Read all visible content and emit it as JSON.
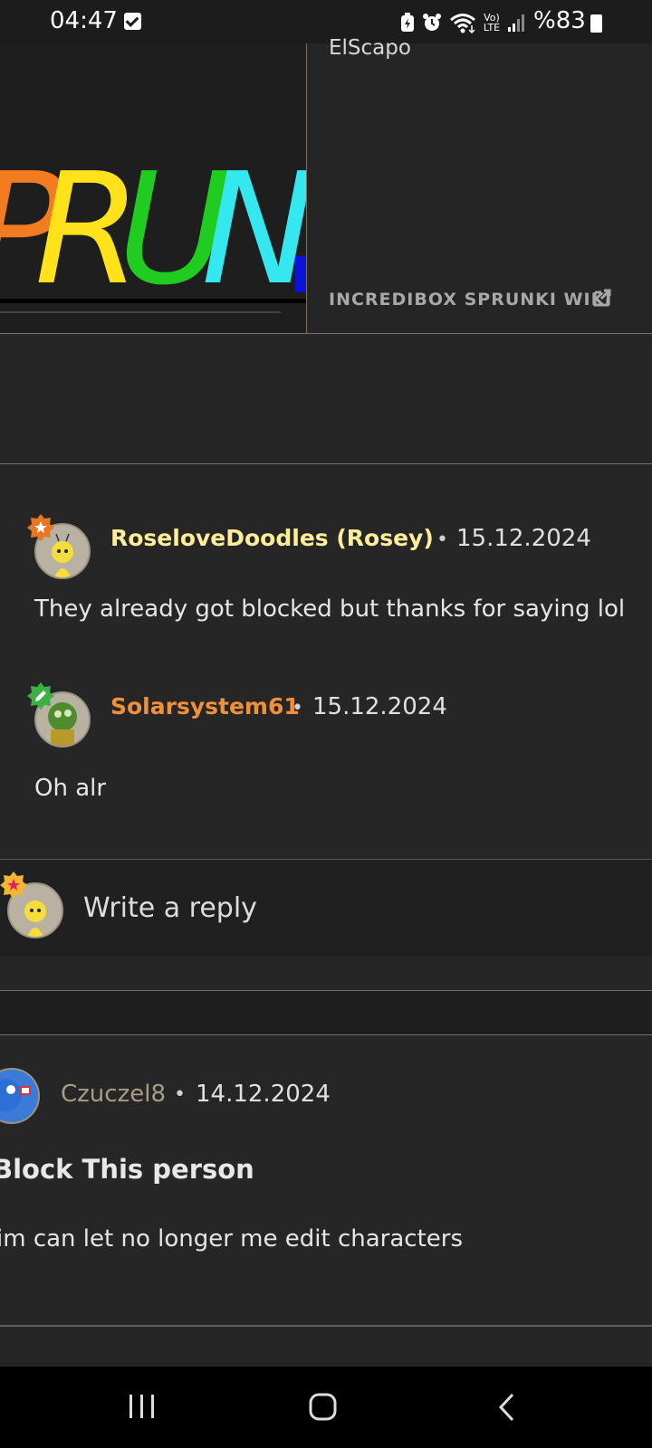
{
  "status_bar": {
    "time": "04:47",
    "battery": "%83",
    "icons": [
      "checkbox-notification-icon",
      "battery-saver-icon",
      "alarm-icon",
      "wifi-icon",
      "volte-icon",
      "signal-icon",
      "battery-icon"
    ]
  },
  "embed": {
    "image_text": "PRUN",
    "author": "ElScapo",
    "source": "INCREDIBOX SPRUNKI WIKI"
  },
  "replies": [
    {
      "username": "RoseloveDoodles (Rosey)",
      "username_color": "#ffee99",
      "separator": "•",
      "date": "15.12.2024",
      "text": "They already got blocked but thanks for saying lol",
      "badge_color": "#e87722"
    },
    {
      "username": "Solarsystem61",
      "username_color": "#f0913a",
      "separator": "•",
      "date": "15.12.2024",
      "text": "Oh alr",
      "badge_color": "#3cb043"
    }
  ],
  "reply_box": {
    "placeholder": "Write a reply",
    "badge_color": "#f2b632"
  },
  "comment": {
    "username": "Czuczel8",
    "username_color": "#a69c88",
    "separator": "•",
    "date": "14.12.2024",
    "title": "Block This person",
    "text": "im can let no longer me edit characters"
  },
  "colors": {
    "background": "#262626",
    "divider": "#7a7160"
  }
}
